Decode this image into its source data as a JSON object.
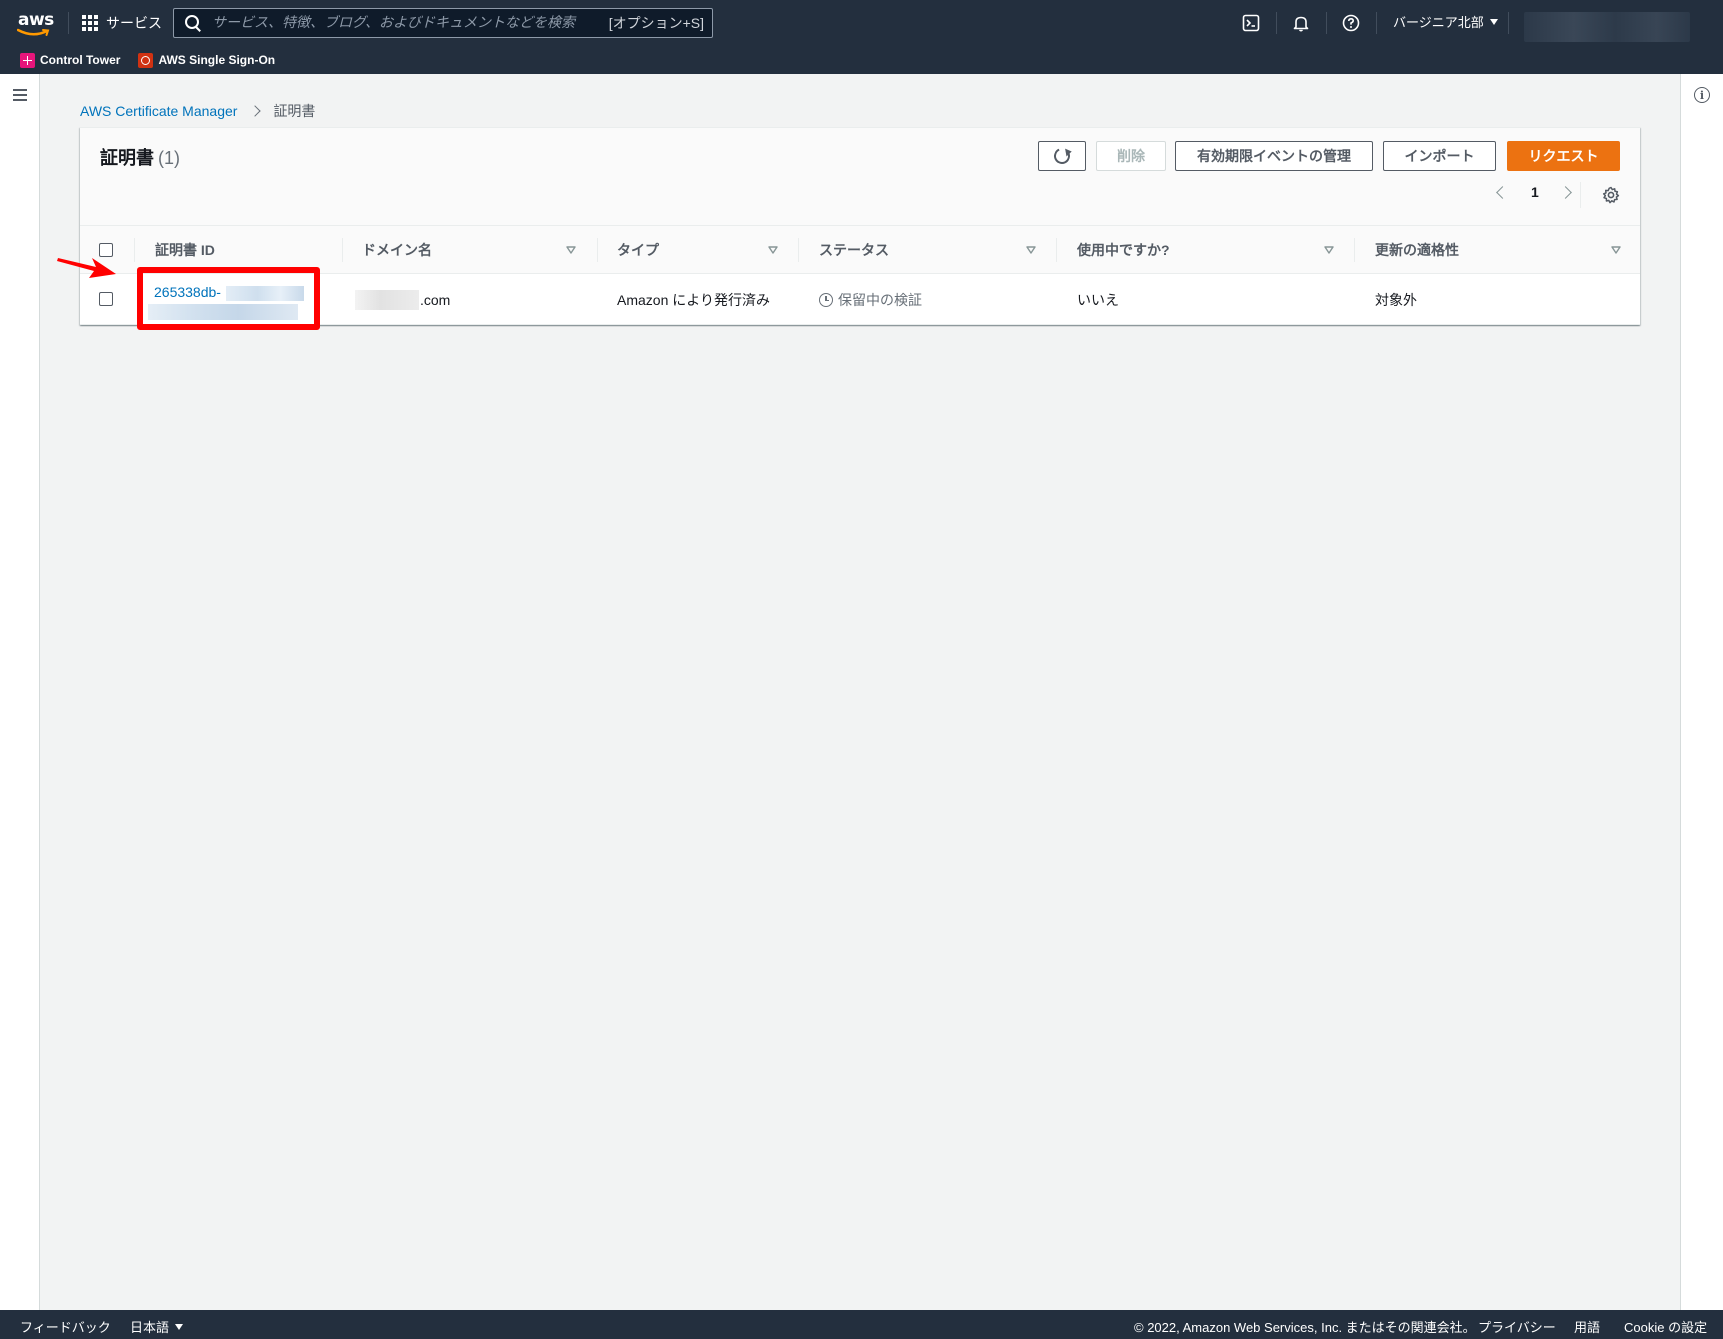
{
  "topnav": {
    "logo_text": "aws",
    "services_label": "サービス",
    "search_placeholder": "サービス、特徴、ブログ、およびドキュメントなどを検索",
    "search_shortcut": "[オプション+S]",
    "region": "バージニア北部",
    "favorites": [
      {
        "label": "Control Tower"
      },
      {
        "label": "AWS Single Sign-On"
      }
    ]
  },
  "breadcrumb": {
    "root": "AWS Certificate Manager",
    "current": "証明書"
  },
  "panel": {
    "title": "証明書",
    "count": "(1)",
    "buttons": {
      "delete": "削除",
      "manage_events": "有効期限イベントの管理",
      "import": "インポート",
      "request": "リクエスト"
    },
    "pagination": {
      "page": "1"
    }
  },
  "table": {
    "columns": [
      "証明書 ID",
      "ドメイン名",
      "タイプ",
      "ステータス",
      "使用中ですか?",
      "更新の適格性"
    ],
    "rows": [
      {
        "cert_id": "265338db-",
        "domain_suffix": ".com",
        "type": "Amazon により発行済み",
        "status": "保留中の検証",
        "in_use": "いいえ",
        "renewal": "対象外"
      }
    ]
  },
  "footer": {
    "feedback": "フィードバック",
    "language": "日本語",
    "copyright": "© 2022, Amazon Web Services, Inc. またはその関連会社。",
    "privacy": "プライバシー",
    "terms": "用語",
    "cookie": "Cookie の設定"
  },
  "colors": {
    "nav_bg": "#232f3e",
    "link": "#0073bb",
    "primary": "#ec7211",
    "highlight": "#ff0000"
  }
}
